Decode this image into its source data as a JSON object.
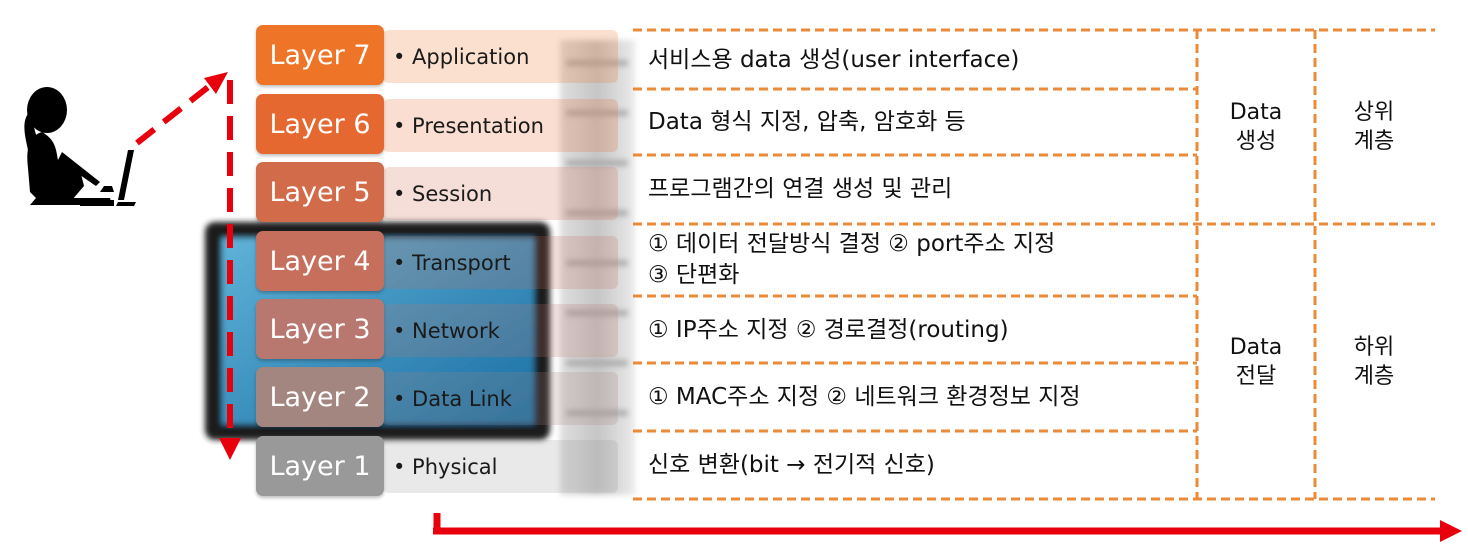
{
  "layers": [
    {
      "badge": "Layer 7",
      "name": "• Application",
      "color": "#ee7427"
    },
    {
      "badge": "Layer 6",
      "name": "• Presentation",
      "color": "#e4682f"
    },
    {
      "badge": "Layer 5",
      "name": "• Session",
      "color": "#d26b49"
    },
    {
      "badge": "Layer 4",
      "name": "• Transport",
      "color": "#c56f5c"
    },
    {
      "badge": "Layer 3",
      "name": "• Network",
      "color": "#b9786f"
    },
    {
      "badge": "Layer 2",
      "name": "• Data Link",
      "color": "#a48680"
    },
    {
      "badge": "Layer 1",
      "name": "• Physical",
      "color": "#9a9999"
    }
  ],
  "descriptions": [
    "서비스용 data 생성(user interface)",
    "Data 형식 지정, 압축, 암호화 등",
    "프로그램간의 연결 생성 및 관리",
    "① 데이터 전달방식 결정 ② port주소 지정",
    "③ 단편화",
    "① IP주소 지정 ② 경로결정(routing)",
    "① MAC주소 지정 ② 네트워크 환경정보 지정",
    "신호 변환(bit → 전기적 신호)"
  ],
  "groups": {
    "upper_data": [
      "Data",
      "생성"
    ],
    "upper_level": [
      "상위",
      "계층"
    ],
    "lower_data": [
      "Data",
      "전달"
    ],
    "lower_level": [
      "하위",
      "계층"
    ]
  },
  "colors": {
    "grid_line": "#ea8a3a",
    "arrow_red": "#e8000d"
  }
}
